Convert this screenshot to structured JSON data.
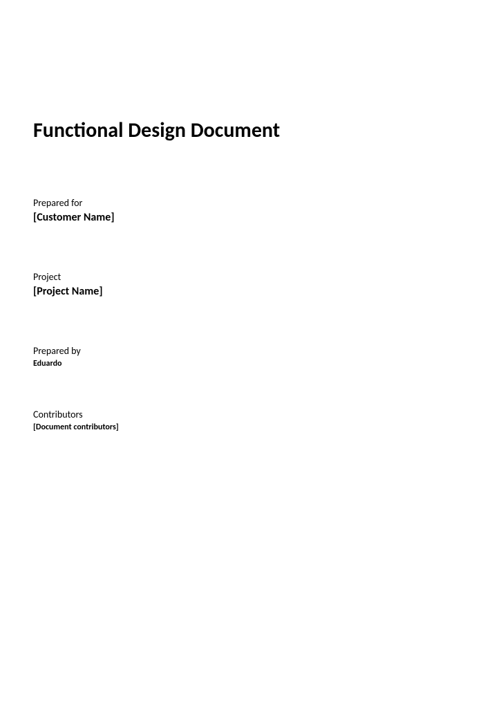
{
  "title": "Functional Design Document",
  "preparedFor": {
    "label": "Prepared for",
    "value": "[Customer Name]"
  },
  "project": {
    "label": "Project",
    "value": "[Project Name]"
  },
  "preparedBy": {
    "label": "Prepared by",
    "value": "Eduardo"
  },
  "contributors": {
    "label": "Contributors",
    "value": "[Document contributors]"
  }
}
